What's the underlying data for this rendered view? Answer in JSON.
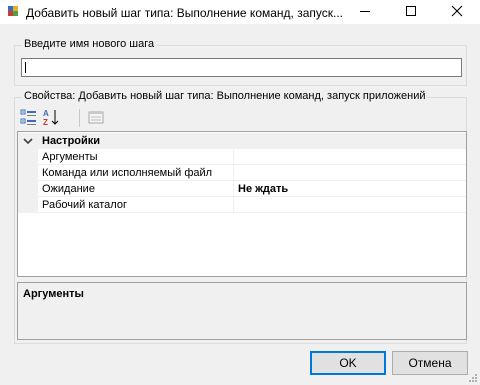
{
  "window": {
    "title": "Добавить новый шаг типа: Выполнение команд, запуск..."
  },
  "name_group": {
    "caption": "Введите имя нового шага",
    "input_value": ""
  },
  "props_group": {
    "caption": "Свойства: Добавить новый шаг типа: Выполнение команд, запуск приложений"
  },
  "grid": {
    "category": "Настройки",
    "rows": [
      {
        "name": "Аргументы",
        "value": ""
      },
      {
        "name": "Команда или исполняемый файл",
        "value": ""
      },
      {
        "name": "Ожидание",
        "value": "Не ждать"
      },
      {
        "name": "Рабочий каталог",
        "value": ""
      }
    ]
  },
  "help": {
    "title": "Аргументы"
  },
  "buttons": {
    "ok": "OK",
    "cancel": "Отмена"
  },
  "colors": {
    "accent": "#0078d7"
  }
}
